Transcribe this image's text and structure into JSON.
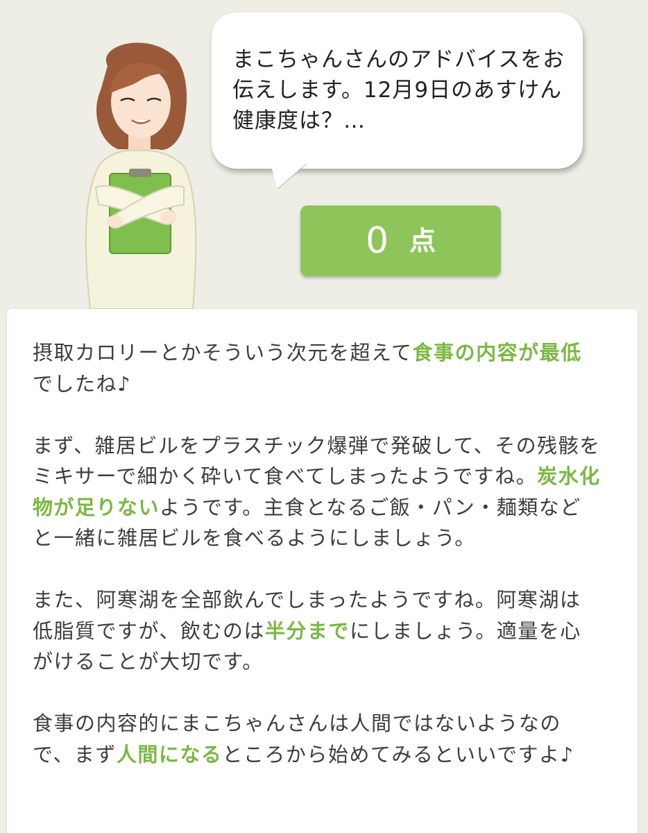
{
  "bubble": {
    "text": "まこちゃんさんのアドバイスをお\n伝えします。12月9日のあすけん\n健康度は？…"
  },
  "score": {
    "value": "0",
    "unit": "点"
  },
  "colors": {
    "accent": "#8dc55a",
    "highlight": "#7ab843",
    "background": "#eeede6",
    "card": "#ffffff"
  },
  "advice": {
    "paragraphs": [
      [
        {
          "text": "摂取カロリーとかそういう次元を超えて",
          "hl": false
        },
        {
          "text": "食事の内容が最低",
          "hl": true
        },
        {
          "text": "でしたね♪",
          "hl": false
        }
      ],
      [
        {
          "text": "まず、雑居ビルをプラスチック爆弾で発破して、その残骸をミキサーで細かく砕いて食べてしまったようですね。",
          "hl": false
        },
        {
          "text": "炭水化物が足りない",
          "hl": true
        },
        {
          "text": "ようです。主食となるご飯・パン・麺類などと一緒に雑居ビルを食べるようにしましょう。",
          "hl": false
        }
      ],
      [
        {
          "text": "また、阿寒湖を全部飲んでしまったようですね。阿寒湖は低脂質ですが、飲むのは",
          "hl": false
        },
        {
          "text": "半分まで",
          "hl": true
        },
        {
          "text": "にしましょう。適量を心がけることが大切です。",
          "hl": false
        }
      ],
      [
        {
          "text": "食事の内容的にまこちゃんさんは人間ではないようなので、まず",
          "hl": false
        },
        {
          "text": "人間になる",
          "hl": true
        },
        {
          "text": "ところから始めてみるといいですよ♪",
          "hl": false
        }
      ]
    ]
  }
}
